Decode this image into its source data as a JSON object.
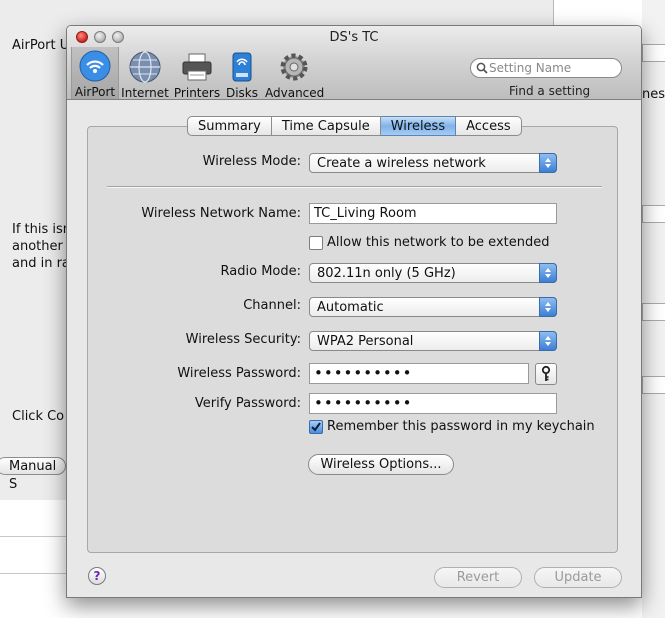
{
  "background": {
    "airport_label": "AirPort U",
    "para_line1": "If this isn",
    "para_line2": "another t",
    "para_line3": "and in ra",
    "click_label": "Click Co",
    "manual_button": "Manual S",
    "right_fragment": "nese"
  },
  "window": {
    "title": "DS's TC"
  },
  "toolbar": {
    "items": [
      {
        "label": "AirPort",
        "icon": "airport-icon",
        "selected": true
      },
      {
        "label": "Internet",
        "icon": "globe-icon",
        "selected": false
      },
      {
        "label": "Printers",
        "icon": "printer-icon",
        "selected": false
      },
      {
        "label": "Disks",
        "icon": "disk-icon",
        "selected": false
      },
      {
        "label": "Advanced",
        "icon": "gear-icon",
        "selected": false
      }
    ],
    "search_placeholder": "Setting Name",
    "find_label": "Find a setting"
  },
  "tabs": [
    {
      "label": "Summary",
      "active": false
    },
    {
      "label": "Time Capsule",
      "active": false
    },
    {
      "label": "Wireless",
      "active": true
    },
    {
      "label": "Access",
      "active": false
    }
  ],
  "wireless": {
    "mode_label": "Wireless Mode:",
    "mode_value": "Create a wireless network",
    "name_label": "Wireless Network Name:",
    "name_value": "TC_Living Room",
    "extend_label": "Allow this network to be extended",
    "extend_checked": false,
    "radio_label": "Radio Mode:",
    "radio_value": "802.11n only (5 GHz)",
    "channel_label": "Channel:",
    "channel_value": "Automatic",
    "security_label": "Wireless Security:",
    "security_value": "WPA2 Personal",
    "password_label": "Wireless Password:",
    "password_value": "••••••••••",
    "verify_label": "Verify Password:",
    "verify_value": "••••••••••",
    "remember_label": "Remember this password in my keychain",
    "remember_checked": true,
    "options_button": "Wireless Options..."
  },
  "footer": {
    "help": "?",
    "revert": "Revert",
    "update": "Update"
  },
  "colors": {
    "accent": "#4a8ee0",
    "help_glyph": "#6a2bb0"
  }
}
